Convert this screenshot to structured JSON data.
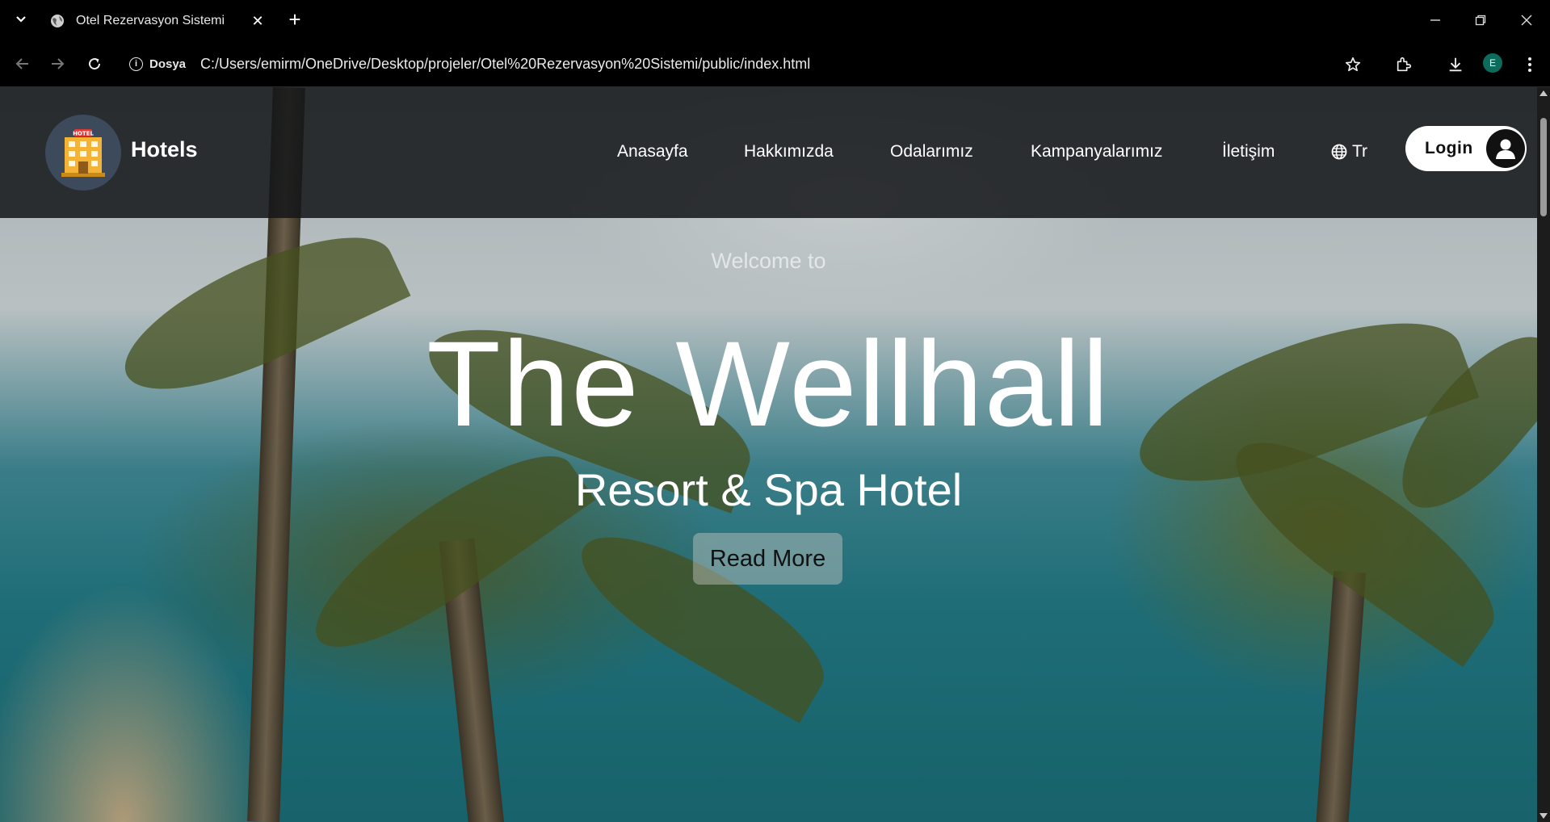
{
  "browser": {
    "tab_title": "Otel Rezervasyon Sistemi",
    "site_info_label": "Dosya",
    "url": "C:/Users/emirm/OneDrive/Desktop/projeler/Otel%20Rezervasyon%20Sistemi/public/index.html",
    "profile_initial": "E",
    "icons": [
      "tab-list-icon",
      "globe-favicon",
      "close-tab-icon",
      "new-tab-icon",
      "minimize-icon",
      "restore-icon",
      "close-window-icon",
      "back-icon",
      "forward-icon",
      "reload-icon",
      "info-icon",
      "star-icon",
      "extensions-icon",
      "download-icon",
      "menu-icon"
    ]
  },
  "navbar": {
    "brand": "Hotels",
    "items": [
      "Anasayfa",
      "Hakkımızda",
      "Odalarımız",
      "Kampanyalarımız",
      "İletişim"
    ],
    "language": "Tr",
    "login_label": "Login"
  },
  "hero": {
    "welcome": "Welcome to",
    "title": "The Wellhall",
    "subtitle": "Resort & Spa Hotel",
    "button": "Read More"
  },
  "colors": {
    "navbar_bg": "#141618",
    "logo_circle": "#3c4a5c",
    "login_bg": "#ffffff",
    "profile_bg": "#0c6b5b"
  }
}
